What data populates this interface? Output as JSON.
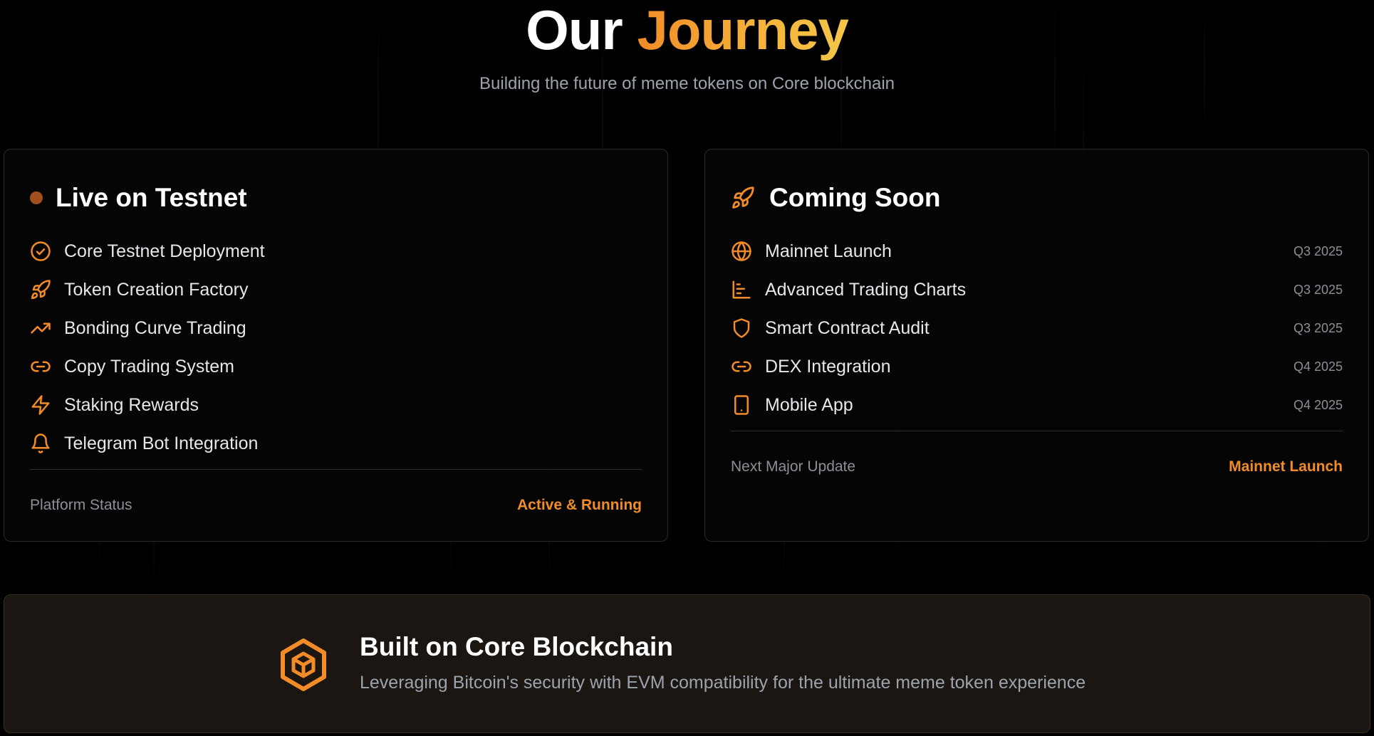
{
  "hero": {
    "title_main": "Our",
    "title_accent": "Journey",
    "subtitle": "Building the future of meme tokens on Core blockchain"
  },
  "colors": {
    "accent": "#f28c28",
    "accent_gold": "#f4c64a",
    "background": "#000000",
    "card_border": "#2a2a2a",
    "muted_text": "#8b8f96",
    "status_dot": "#a0501c"
  },
  "live_card": {
    "title": "Live on Testnet",
    "items": [
      {
        "icon": "check-circle-icon",
        "label": "Core Testnet Deployment"
      },
      {
        "icon": "rocket-icon",
        "label": "Token Creation Factory"
      },
      {
        "icon": "trending-up-icon",
        "label": "Bonding Curve Trading"
      },
      {
        "icon": "link-icon",
        "label": "Copy Trading System"
      },
      {
        "icon": "lightning-icon",
        "label": "Staking Rewards"
      },
      {
        "icon": "bell-icon",
        "label": "Telegram Bot Integration"
      }
    ],
    "footer_label": "Platform Status",
    "footer_value": "Active & Running"
  },
  "soon_card": {
    "title": "Coming Soon",
    "header_icon": "rocket-icon",
    "items": [
      {
        "icon": "globe-icon",
        "label": "Mainnet Launch",
        "when": "Q3 2025"
      },
      {
        "icon": "bar-chart-icon",
        "label": "Advanced Trading Charts",
        "when": "Q3 2025"
      },
      {
        "icon": "shield-icon",
        "label": "Smart Contract Audit",
        "when": "Q3 2025"
      },
      {
        "icon": "link-icon",
        "label": "DEX Integration",
        "when": "Q4 2025"
      },
      {
        "icon": "smartphone-icon",
        "label": "Mobile App",
        "when": "Q4 2025"
      }
    ],
    "footer_label": "Next Major Update",
    "footer_value": "Mainnet Launch"
  },
  "banner": {
    "icon": "cube-icon",
    "title": "Built on Core Blockchain",
    "subtitle": "Leveraging Bitcoin's security with EVM compatibility for the ultimate meme token experience"
  }
}
